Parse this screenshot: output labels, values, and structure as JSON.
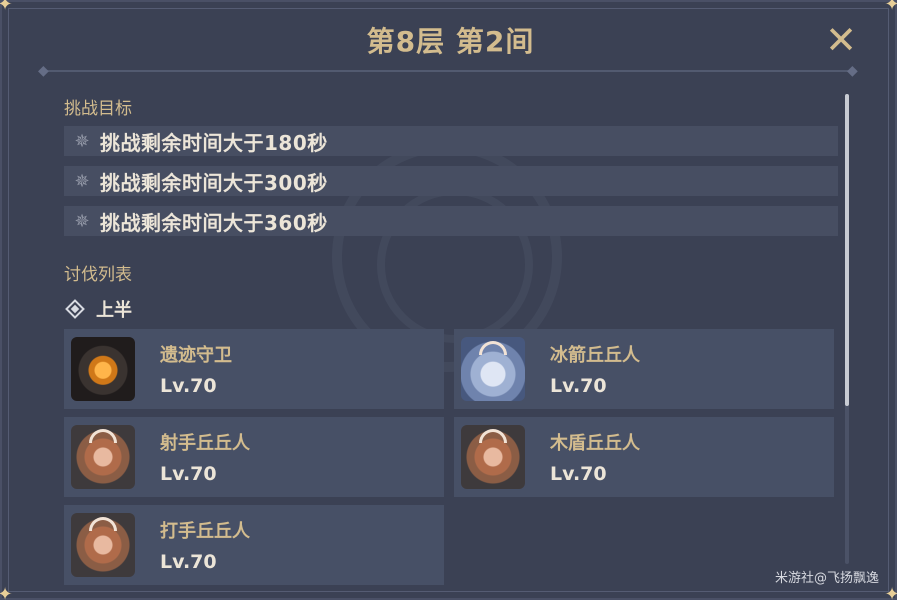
{
  "header": {
    "title": "第8层 第2间",
    "close_icon": "close-icon"
  },
  "goals": {
    "section_label": "挑战目标",
    "items": [
      {
        "icon": "star-icon",
        "text": "挑战剩余时间大于180秒"
      },
      {
        "icon": "star-icon",
        "text": "挑战剩余时间大于300秒"
      },
      {
        "icon": "star-icon",
        "text": "挑战剩余时间大于360秒"
      }
    ]
  },
  "enemies": {
    "section_label": "讨伐列表",
    "half_label": "上半",
    "items": [
      {
        "name": "遗迹守卫",
        "level": "Lv.70",
        "portrait": "ruin-guard"
      },
      {
        "name": "冰箭丘丘人",
        "level": "Lv.70",
        "portrait": "cryo-hilichurl"
      },
      {
        "name": "射手丘丘人",
        "level": "Lv.70",
        "portrait": "hilichurl"
      },
      {
        "name": "木盾丘丘人",
        "level": "Lv.70",
        "portrait": "hilichurl"
      },
      {
        "name": "打手丘丘人",
        "level": "Lv.70",
        "portrait": "hilichurl"
      }
    ]
  },
  "credit": "米游社@飞扬飘逸",
  "colors": {
    "background": "#3b4154",
    "gold_text": "#d3bc8e",
    "light_text": "#ece5d8",
    "card_bg": "#475066"
  }
}
